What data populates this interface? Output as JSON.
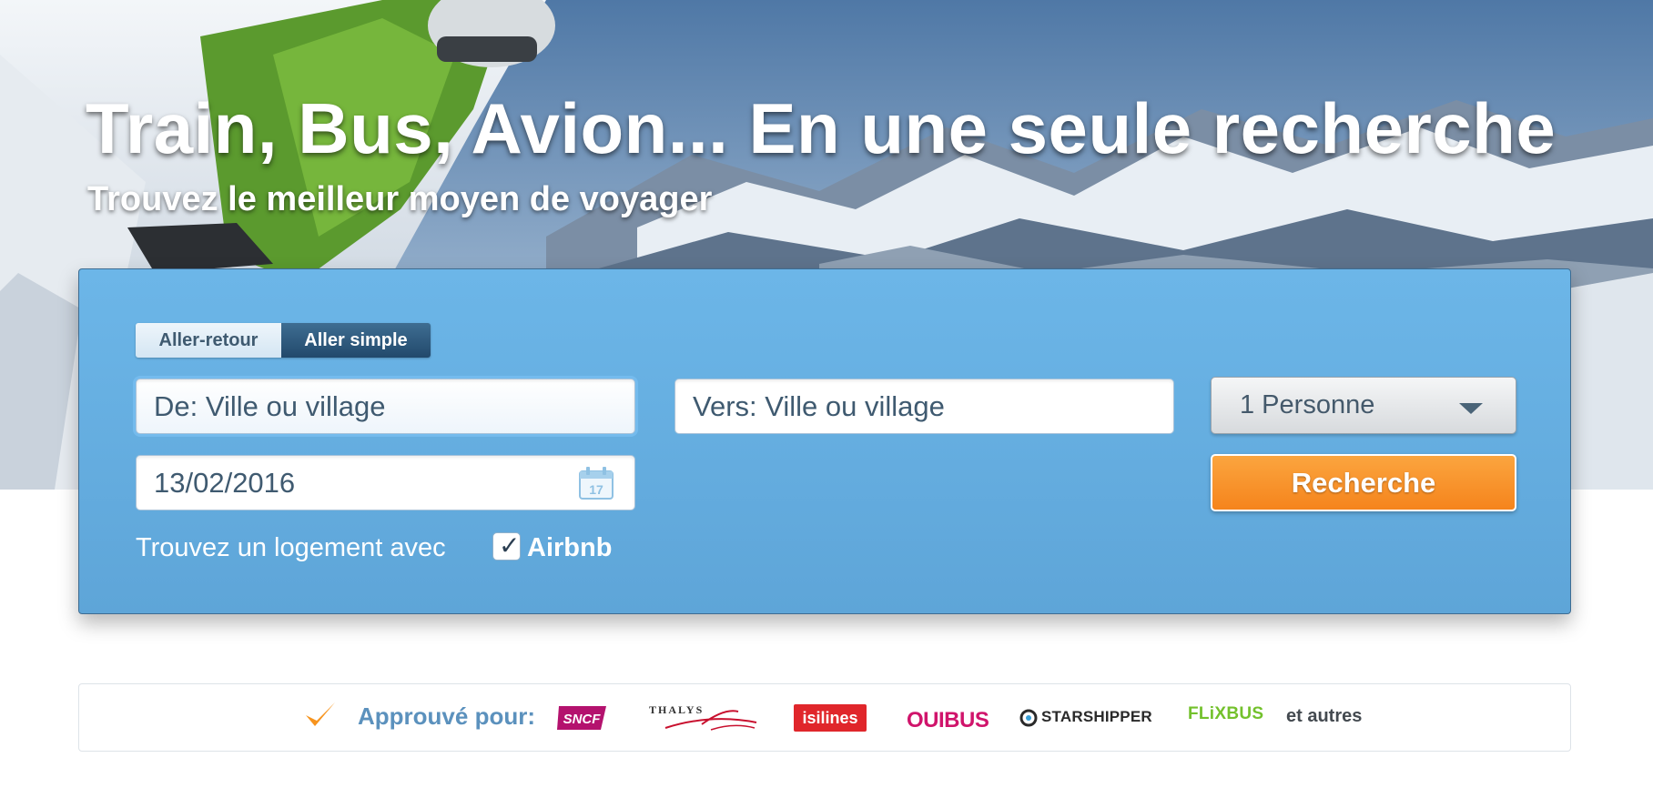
{
  "hero": {
    "title": "Train, Bus, Avion... En une seule recherche",
    "subtitle": "Trouvez le meilleur moyen de voyager"
  },
  "search": {
    "trip_type": {
      "round_trip_label": "Aller-retour",
      "one_way_label": "Aller simple",
      "selected": "Aller simple"
    },
    "from_placeholder": "De: Ville ou village",
    "to_placeholder": "Vers: Ville ou village",
    "date_value": "13/02/2016",
    "calendar_icon_day": "17",
    "persons_value": "1 Personne",
    "submit_label": "Recherche",
    "airbnb_label": "Trouvez un logement avec",
    "airbnb_checked": true,
    "airbnb_brand": "Airbnb"
  },
  "approved": {
    "label": "Approuvé pour:",
    "partners": [
      "SNCF",
      "THALYS",
      "isilines",
      "OUIBUS",
      "STARSHIPPER",
      "FLiXBUS"
    ],
    "more_label": "et autres"
  },
  "colors": {
    "panel_blue": "#6cb6e8",
    "active_toggle": "#22496b",
    "search_orange": "#f5841c",
    "approved_text": "#5b91bd",
    "sncf_magenta": "#b4126e",
    "isilines_red": "#e0262b",
    "ouibus_pink": "#d0146b",
    "flixbus_green": "#73c12c"
  },
  "icons": {
    "calendar": "calendar-icon",
    "dropdown": "caret-down-icon",
    "checkbox": "check-icon",
    "approved": "checkmark-icon"
  }
}
